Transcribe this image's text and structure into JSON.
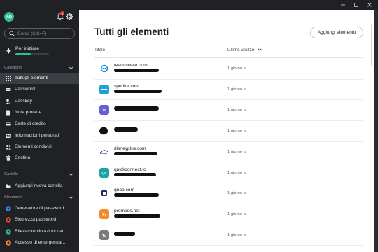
{
  "window": {
    "minimize_icon": "minimize-icon",
    "maximize_icon": "maximize-icon",
    "close_icon": "close-icon"
  },
  "sidebar": {
    "avatar_initials": "AB",
    "notification_count": "1",
    "search_placeholder": "Cerca (Ctrl+F)",
    "getting_started": {
      "label": "Per iniziare",
      "progress": 0.45,
      "color": "#2fbf8f"
    },
    "categories_header": "Categorie",
    "categories": [
      {
        "label": "Tutti gli elementi",
        "icon": "grid-icon",
        "active": true
      },
      {
        "label": "Password",
        "icon": "password-icon",
        "active": false
      },
      {
        "label": "Passkey",
        "icon": "passkey-icon",
        "active": false
      },
      {
        "label": "Note protette",
        "icon": "note-icon",
        "active": false
      },
      {
        "label": "Carte di credito",
        "icon": "credit-card-icon",
        "active": false
      },
      {
        "label": "Informazioni personali",
        "icon": "person-card-icon",
        "active": false
      },
      {
        "label": "Elementi condivisi",
        "icon": "shared-icon",
        "active": false
      },
      {
        "label": "Cestino",
        "icon": "trash-icon",
        "active": false
      }
    ],
    "folders_header": "Cartelle",
    "add_folder_label": "Aggiungi nuova cartella",
    "tools_header": "Strumenti",
    "tools": [
      {
        "label": "Generatore di password",
        "icon": "generator-icon",
        "color": "#3b82f6"
      },
      {
        "label": "Sicurezza password",
        "icon": "health-icon",
        "color": "#e6433f"
      },
      {
        "label": "Rilevatore violazioni dati",
        "icon": "breach-icon",
        "color": "#2fbf8f"
      },
      {
        "label": "Accesso di emergenza...",
        "icon": "emergency-icon",
        "color": "#f28c28"
      }
    ]
  },
  "main": {
    "title": "Tutti gli elementi",
    "add_button": "Aggiungi elemento",
    "col_title": "Titolo",
    "col_sort": "Ultimo utilizzo",
    "items": [
      {
        "name": "teamviewer.com",
        "time": "1 giorno fa",
        "logo_text": "",
        "logo_bg": "#ffffff",
        "logo": "teamviewer"
      },
      {
        "name": "spedire.com",
        "time": "1 giorno fa",
        "logo_text": "",
        "logo_bg": "#1aa3d4",
        "logo": "spedire"
      },
      {
        "name": "",
        "time": "1 giorno fa",
        "logo_text": "19",
        "logo_bg": "#6b5fd6",
        "logo": "text"
      },
      {
        "name": "",
        "time": "1 giorno fa",
        "logo_text": "",
        "logo_bg": "#111111",
        "logo": "blob"
      },
      {
        "name": "disneyplus.com",
        "time": "1 giorno fa",
        "logo_text": "Disney+",
        "logo_bg": "#ffffff",
        "logo": "disney"
      },
      {
        "name": "quickconnect.to",
        "time": "1 giorno fa",
        "logo_text": "Qu",
        "logo_bg": "#1aa3a8",
        "logo": "text"
      },
      {
        "name": "qnap.com",
        "time": "1 giorno fa",
        "logo_text": "",
        "logo_bg": "#1f2a5a",
        "logo": "qnap"
      },
      {
        "name": "promods.net",
        "time": "1 giorno fa",
        "logo_text": "Pr",
        "logo_bg": "#f28c28",
        "logo": "text"
      },
      {
        "name": "",
        "time": "1 giorno fa",
        "logo_text": "Tu",
        "logo_bg": "#7a7a7a",
        "logo": "text"
      }
    ]
  }
}
